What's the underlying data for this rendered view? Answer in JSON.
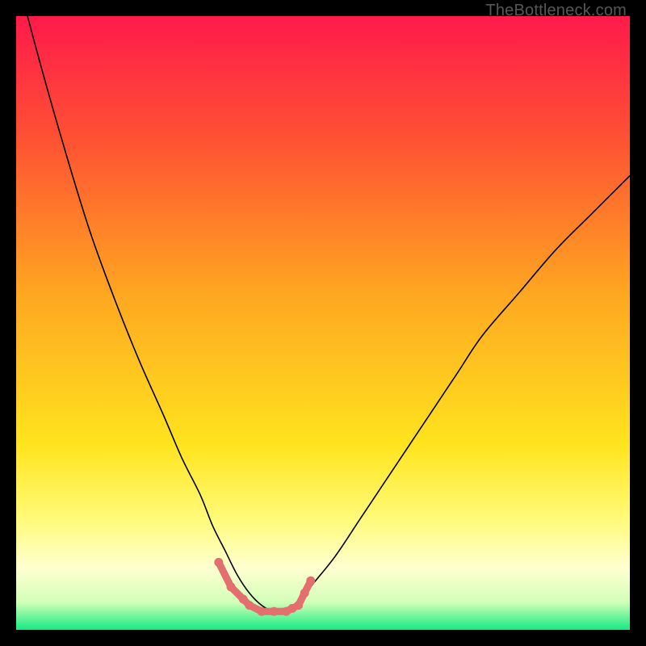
{
  "watermark": "TheBottleneck.com",
  "chart_data": {
    "type": "line",
    "title": "",
    "xlabel": "",
    "ylabel": "",
    "xlim": [
      0,
      100
    ],
    "ylim": [
      0,
      100
    ],
    "background_gradient_stops": [
      {
        "offset": 0.0,
        "color": "#ff1a4b"
      },
      {
        "offset": 0.2,
        "color": "#ff5133"
      },
      {
        "offset": 0.45,
        "color": "#ffa621"
      },
      {
        "offset": 0.7,
        "color": "#ffe41e"
      },
      {
        "offset": 0.82,
        "color": "#fffb7a"
      },
      {
        "offset": 0.9,
        "color": "#ffffd0"
      },
      {
        "offset": 0.955,
        "color": "#d2ffb8"
      },
      {
        "offset": 0.975,
        "color": "#7df7a0"
      },
      {
        "offset": 1.0,
        "color": "#17e884"
      }
    ],
    "series": [
      {
        "name": "bottleneck-curve",
        "stroke": "#000000",
        "stroke_width": 1.6,
        "x": [
          0,
          4,
          8,
          12,
          16,
          20,
          24,
          27,
          30,
          32,
          34,
          36,
          38,
          40,
          42,
          44,
          46,
          48,
          52,
          56,
          60,
          64,
          68,
          72,
          76,
          82,
          88,
          94,
          100
        ],
        "values": [
          107,
          92,
          78,
          65,
          54,
          44,
          35,
          28,
          22,
          17,
          13,
          9,
          6,
          4,
          3,
          3,
          4,
          7,
          12,
          18,
          24,
          30,
          36,
          42,
          48,
          55,
          62,
          68,
          74
        ]
      }
    ],
    "markers": {
      "name": "bottom-emphasis",
      "stroke": "#e46f6f",
      "stroke_width": 9,
      "dot_radius": 5.5,
      "x": [
        33,
        35,
        37,
        38,
        40,
        42,
        44,
        45,
        46,
        47,
        48
      ],
      "values": [
        11,
        7,
        5,
        4,
        3,
        3,
        3,
        3.5,
        4,
        6,
        8
      ]
    }
  }
}
